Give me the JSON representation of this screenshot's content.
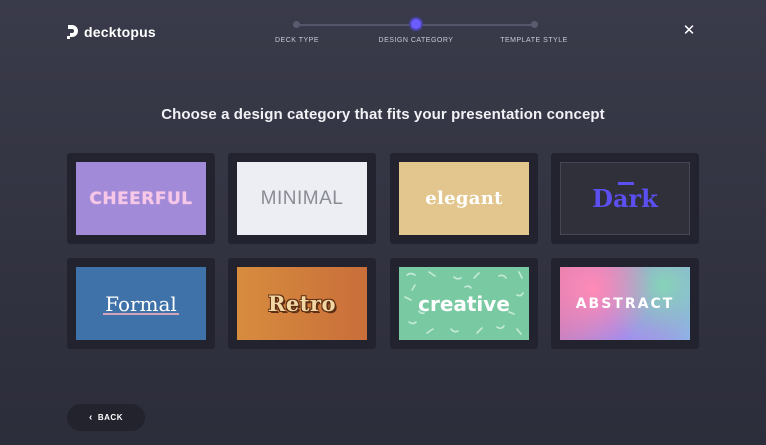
{
  "app": {
    "name": "decktopus"
  },
  "stepper": {
    "steps": [
      {
        "label": "DECK TYPE",
        "active": false
      },
      {
        "label": "DESIGN CATEGORY",
        "active": true
      },
      {
        "label": "TEMPLATE STYLE",
        "active": false
      }
    ]
  },
  "header": {
    "close_icon": "close-icon"
  },
  "page": {
    "heading": "Choose a design category that fits your presentation concept"
  },
  "categories": [
    {
      "label": "CHEERFUL",
      "color": "#a18ad8"
    },
    {
      "label": "MINIMAL",
      "color": "#eceef3"
    },
    {
      "label": "elegant",
      "color": "#e2c68e"
    },
    {
      "label": "Dark",
      "color": "#2f3039"
    },
    {
      "label": "Formal",
      "color": "#3f72a8"
    },
    {
      "label": "Retro",
      "color": "#d78c3e"
    },
    {
      "label": "creative",
      "color": "#79c9a3"
    },
    {
      "label": "ABSTRACT",
      "color": "#e57aa6"
    }
  ],
  "footer": {
    "back_label": "BACK"
  },
  "colors": {
    "accent": "#6a5cff",
    "background": "#33343f",
    "card": "#22232e"
  }
}
